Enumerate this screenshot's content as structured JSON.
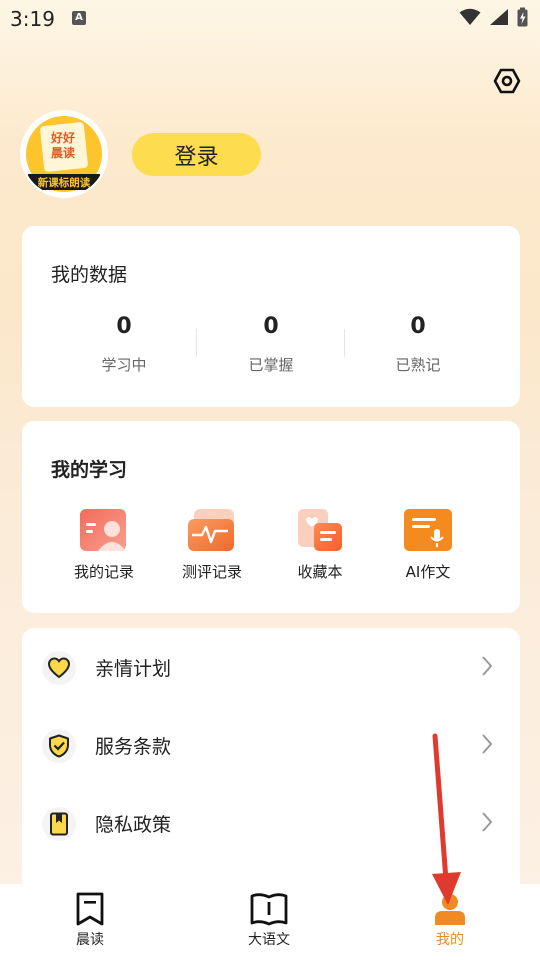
{
  "status_bar": {
    "time": "3:19",
    "app_icon_letter": "A"
  },
  "profile": {
    "avatar_top_text": "好好",
    "avatar_middle_text": "晨读",
    "avatar_bottom_text": "新课标朗读",
    "login_label": "登录"
  },
  "my_data": {
    "title": "我的数据",
    "stats": [
      {
        "value": "0",
        "label": "学习中"
      },
      {
        "value": "0",
        "label": "已掌握"
      },
      {
        "value": "0",
        "label": "已熟记"
      }
    ]
  },
  "my_study": {
    "title": "我的学习",
    "items": [
      {
        "label": "我的记录",
        "icon": "record-icon"
      },
      {
        "label": "测评记录",
        "icon": "assessment-icon"
      },
      {
        "label": "收藏本",
        "icon": "favorites-icon"
      },
      {
        "label": "AI作文",
        "icon": "ai-essay-icon"
      }
    ]
  },
  "menu": {
    "items": [
      {
        "label": "亲情计划",
        "icon": "heart-icon"
      },
      {
        "label": "服务条款",
        "icon": "shield-check-icon"
      },
      {
        "label": "隐私政策",
        "icon": "bookmark-icon"
      }
    ]
  },
  "bottom_nav": {
    "items": [
      {
        "label": "晨读",
        "icon": "bookmark-outline-icon",
        "active": false
      },
      {
        "label": "大语文",
        "icon": "open-book-icon",
        "active": false
      },
      {
        "label": "我的",
        "icon": "person-icon",
        "active": true
      }
    ]
  },
  "colors": {
    "accent_orange": "#f08a24",
    "login_yellow": "#fddc4d",
    "annotation_red": "#e03a2e"
  }
}
